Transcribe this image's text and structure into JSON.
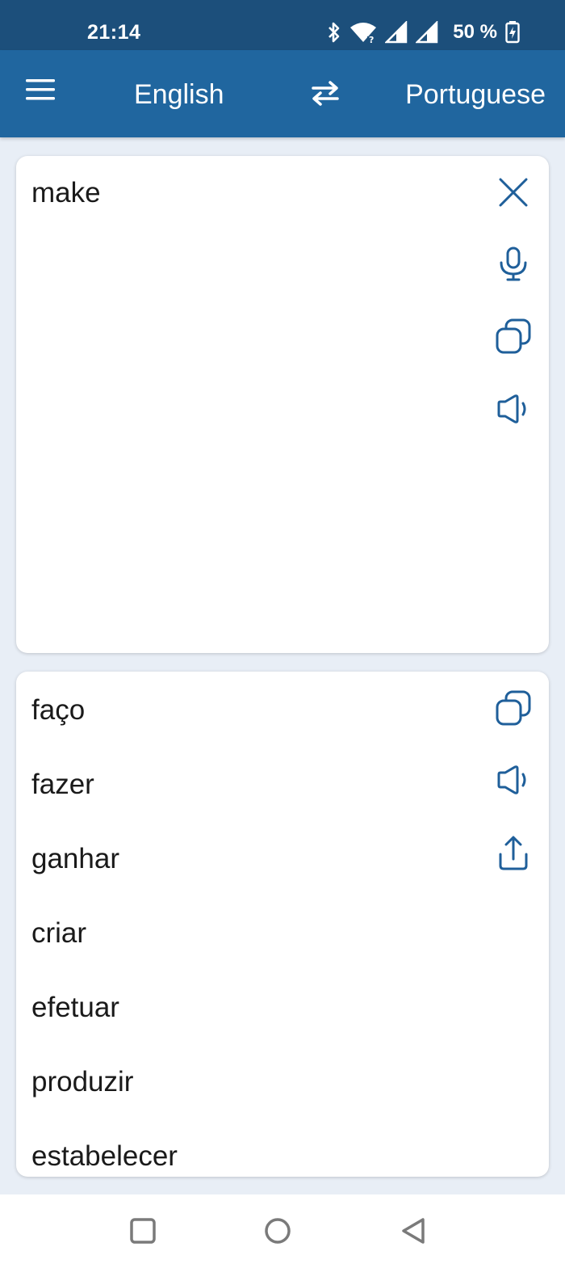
{
  "status_bar": {
    "time": "21:14",
    "battery": "50 %",
    "icons": [
      "bluetooth-icon",
      "wifi-icon",
      "signal-icon",
      "signal-icon",
      "battery-charging-icon"
    ]
  },
  "app_bar": {
    "source_language": "English",
    "target_language": "Portuguese",
    "icons": [
      "menu-icon",
      "swap-icon"
    ]
  },
  "input": {
    "text": "make",
    "actions": [
      "close-icon",
      "microphone-icon",
      "copy-icon",
      "speaker-icon"
    ]
  },
  "output": {
    "results": [
      "faço",
      "fazer",
      "ganhar",
      "criar",
      "efetuar",
      "produzir",
      "estabelecer"
    ],
    "actions": [
      "copy-icon",
      "speaker-icon",
      "share-icon"
    ]
  },
  "colors": {
    "status_bar": "#1c4f7b",
    "app_bar": "#20669f",
    "accent": "#1f5f9a",
    "background": "#e8eef6"
  },
  "nav_bar": {
    "icons": [
      "recents-square-icon",
      "home-circle-icon",
      "back-triangle-icon"
    ]
  }
}
